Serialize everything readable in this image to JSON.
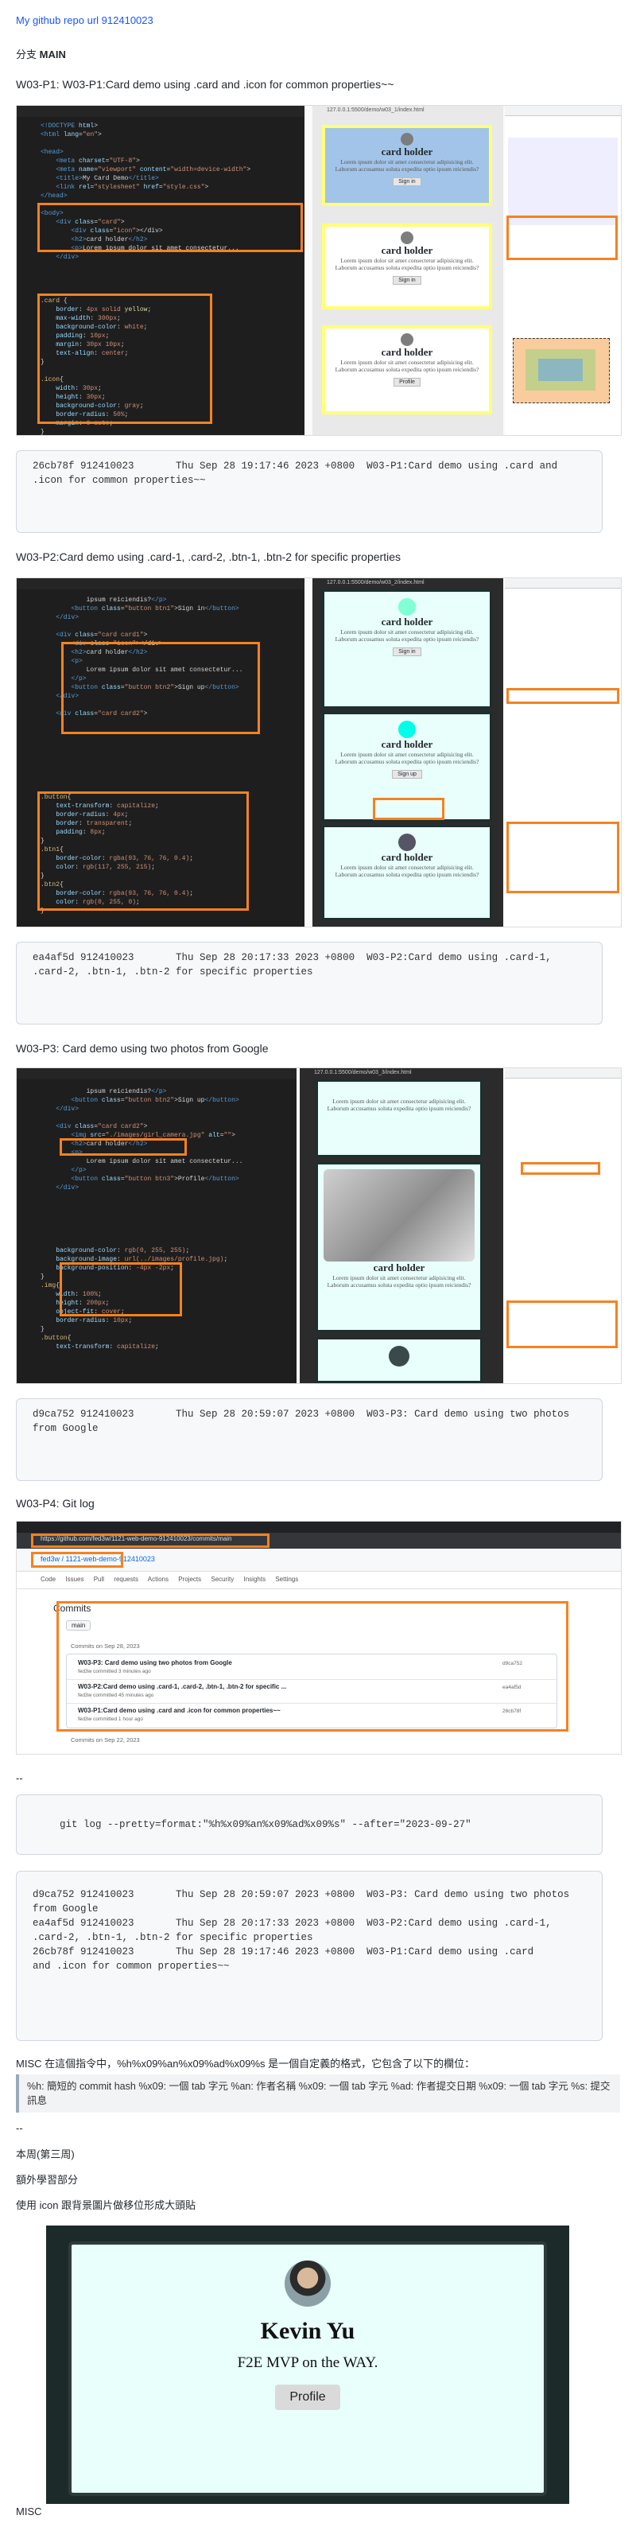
{
  "header": {
    "repo_link": "My github repo url 912410023",
    "branch_prefix": "分支 ",
    "branch_name": "MAIN"
  },
  "sections": [
    {
      "title": "W03-P1: W03-P1:Card demo using .card and .icon for common properties~~",
      "commit": "26cb78f 912410023       Thu Sep 28 19:17:46 2023 +0800  W03-P1:Card demo using .card and\n.icon for common properties~~"
    },
    {
      "title": "W03-P2:Card demo using .card-1, .card-2, .btn-1, .btn-2 for specific properties",
      "commit": "ea4af5d 912410023       Thu Sep 28 20:17:33 2023 +0800  W03-P2:Card demo using .card-1,\n.card-2, .btn-1, .btn-2 for specific properties"
    },
    {
      "title": "W03-P3: Card demo using two photos from Google",
      "commit": "d9ca752 912410023       Thu Sep 28 20:59:07 2023 +0800  W03-P3: Card demo using two photos\nfrom Google"
    },
    {
      "title": "W03-P4: Git log"
    }
  ],
  "shot1": {
    "card_title": "card holder",
    "card_text": "Lorem ipsum dolor sit amet consectetur adipisicing elit. Laborum accusamus soluta expedita optio ipsum reiciendis?",
    "btn_signin": "Sign in",
    "btn_profile": "Profile",
    "url": "127.0.0.1:5500/demo/w03_1/index.html"
  },
  "shot2": {
    "card_title": "card holder",
    "btn_signin": "Sign in",
    "btn_signup": "Sign up",
    "url": "127.0.0.1:5500/demo/w03_2/index.html"
  },
  "shot3": {
    "card_title": "card holder",
    "url": "127.0.0.1:5500/demo/w03_3/index.html"
  },
  "github": {
    "url": "https://github.com/fed3w/1121-web-demo-912410023/commits/main",
    "repo": "fed3w / 1121-web-demo-912410023",
    "nav": [
      "Code",
      "Issues",
      "Pull requests",
      "Actions",
      "Projects",
      "Security",
      "Insights",
      "Settings"
    ],
    "heading": "Commits",
    "branch": "main",
    "group1": "Commits on Sep 28, 2023",
    "commits": [
      {
        "msg": "W03-P3: Card demo using two photos from Google",
        "meta": "fed3w committed 3 minutes ago",
        "sha": "d9ca752"
      },
      {
        "msg": "W03-P2:Card demo using .card-1, .card-2, .btn-1, .btn-2 for specific ...",
        "meta": "fed3w committed 45 minutes ago",
        "sha": "ea4af5d"
      },
      {
        "msg": "W03-P1:Card demo using .card and .icon for common properties~~",
        "meta": "fed3w committed 1 hour ago",
        "sha": "26cb78f"
      }
    ],
    "group2": "Commits on Sep 22, 2023"
  },
  "dashes1": "--",
  "gitlog_cmd": "git log --pretty=format:\"%h%x09%an%x09%ad%x09%s\" --after=\"2023-09-27\"",
  "gitlog_out": "d9ca752 912410023       Thu Sep 28 20:59:07 2023 +0800  W03-P3: Card demo using two photos\nfrom Google\nea4af5d 912410023       Thu Sep 28 20:17:33 2023 +0800  W03-P2:Card demo using .card-1,\n.card-2, .btn-1, .btn-2 for specific properties\n26cb78f 912410023       Thu Sep 28 19:17:46 2023 +0800  W03-P1:Card demo using .card\nand .icon for common properties~~",
  "misc_text": "MISC 在這個指令中，%h%x09%an%x09%ad%x09%s 是一個自定義的格式，它包含了以下的欄位：",
  "misc_note": "%h: 簡短的 commit hash %x09: 一個 tab 字元 %an: 作者名稱 %x09: 一個 tab 字元 %ad: 作者提交日期 %x09: 一個 tab 字元 %s: 提交訊息",
  "dashes2": "--",
  "week": "本周(第三周)",
  "extra": "額外學習部分",
  "icon_line": "使用 icon 跟背景圖片做移位形成大頭貼",
  "profile": {
    "name": "Kevin Yu",
    "tagline": "F2E MVP on the WAY.",
    "button": "Profile"
  },
  "footer_misc": "MISC"
}
